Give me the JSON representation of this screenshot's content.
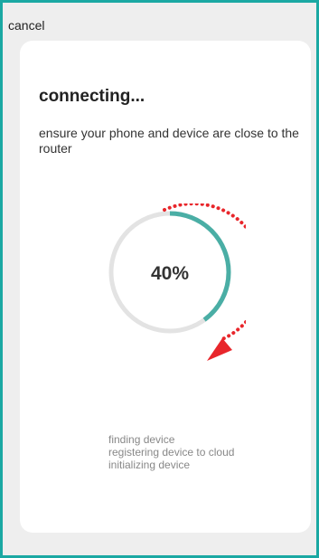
{
  "header": {
    "cancel_label": "cancel"
  },
  "card": {
    "title": "connecting...",
    "subtitle": "ensure your phone and device are close to the router"
  },
  "progress": {
    "value": 40,
    "label": "40%"
  },
  "steps": [
    "finding device",
    "registering device to cloud",
    "initializing device"
  ],
  "colors": {
    "border": "#1aa8a3",
    "progress_fill": "#4aaea5",
    "progress_track": "#e3e3e3",
    "arrow_annotation": "#e8262b"
  }
}
